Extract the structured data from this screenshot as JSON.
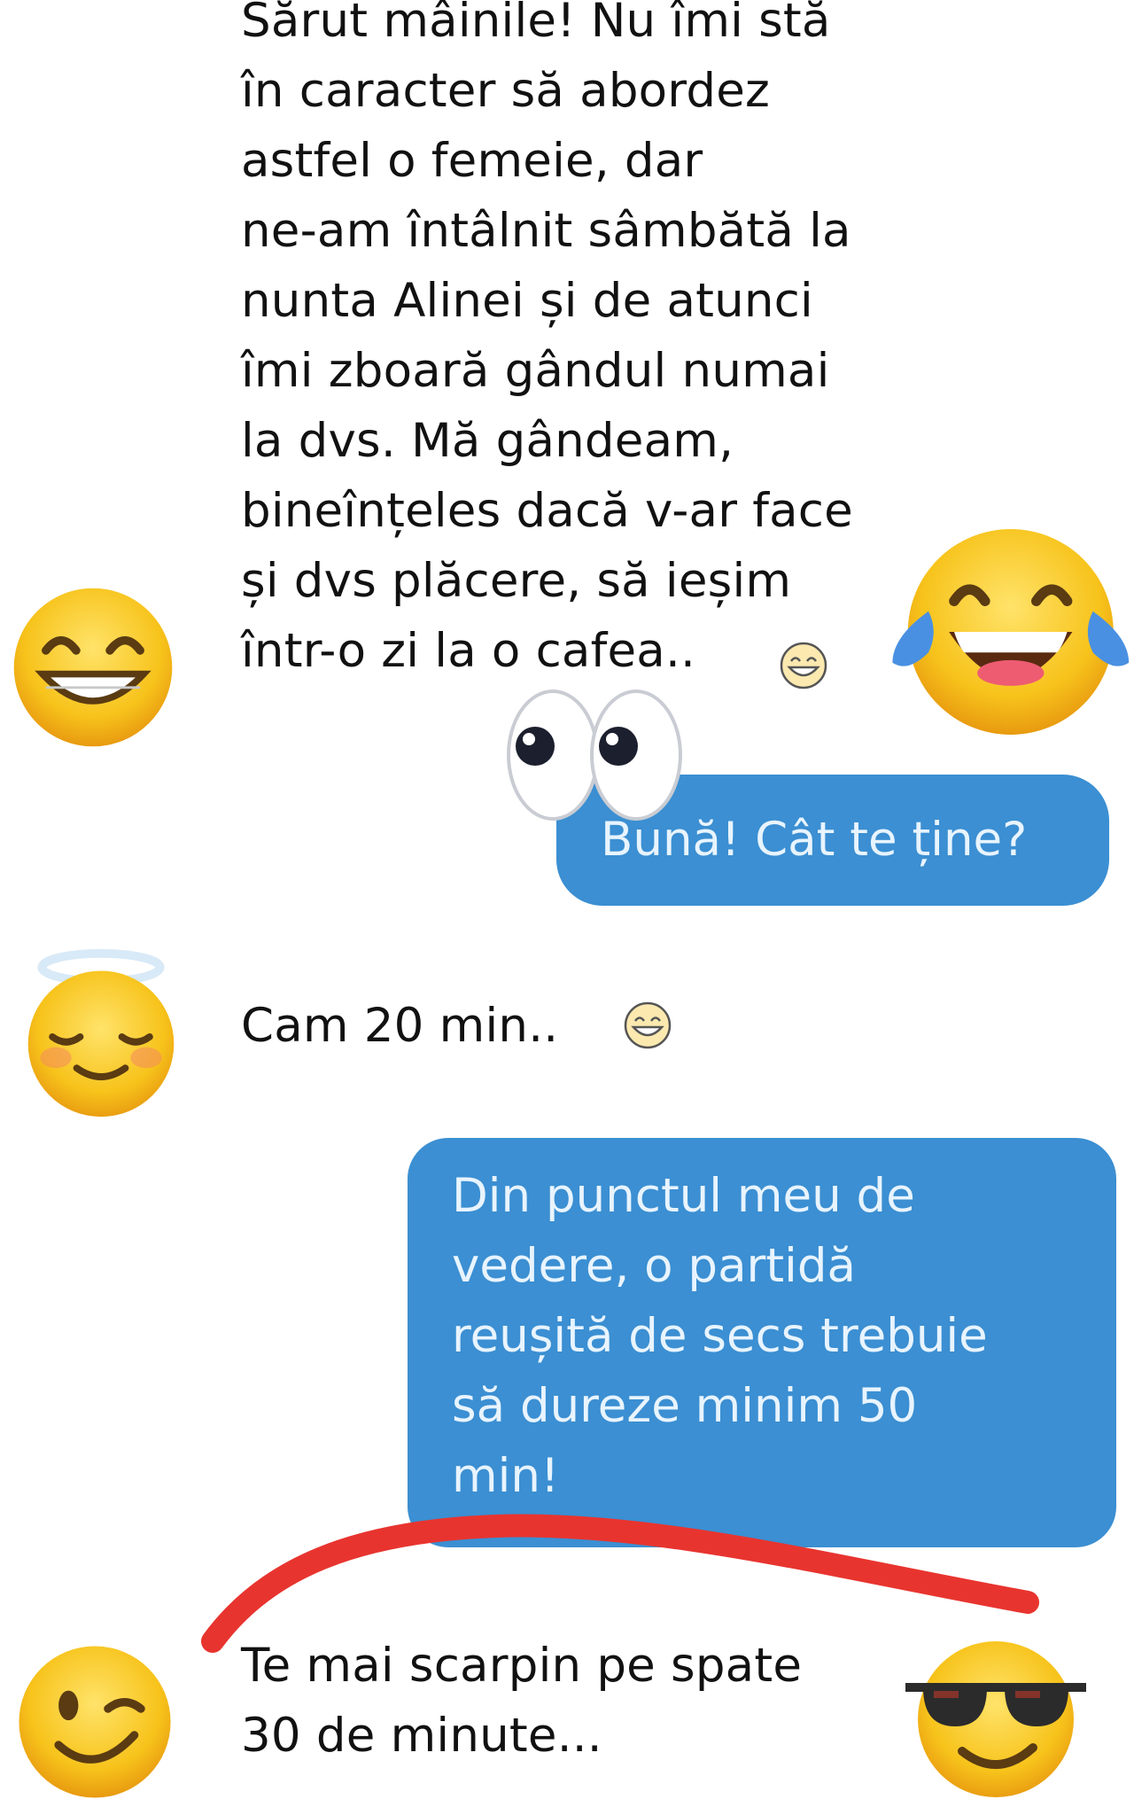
{
  "conversation": {
    "messages": [
      {
        "side": "incoming",
        "text": "Sărut mâinile! Nu îmi stă\nîn caracter să abordez\nastfel o femeie, dar\nne-am întâlnit sâmbătă la\nnunta Alinei și de atunci\nîmi zboară gândul numai\nla dvs. Mă gândeam,\nbineînțeles dacă v-ar face\nși dvs plăcere, să ieșim\nîntr-o zi la o cafea..",
        "trailing_emoji": "grinning-face"
      },
      {
        "side": "outgoing",
        "text": "Bună! Cât te ține?"
      },
      {
        "side": "incoming",
        "text": "Cam 20 min..",
        "trailing_emoji": "grinning-face"
      },
      {
        "side": "outgoing",
        "text": "Din punctul meu de\nvedere, o partidă\nreușită de secs trebuie\nsă dureze minim 50\nmin!"
      },
      {
        "side": "incoming",
        "text": "Te mai scarpin pe spate\n30 de minute..."
      }
    ]
  },
  "stickers": [
    {
      "name": "grinning-face-icon"
    },
    {
      "name": "tears-of-joy-face-icon"
    },
    {
      "name": "eyes-icon"
    },
    {
      "name": "smiling-face-with-halo-icon"
    },
    {
      "name": "winking-face-icon"
    },
    {
      "name": "face-with-sunglasses-icon"
    }
  ],
  "colors": {
    "background": "#ffffff",
    "outgoing_bubble": "#3b8fd2",
    "outgoing_text": "#e8f4ff",
    "incoming_text": "#111111",
    "annotation_stroke": "#e8342f",
    "emoji_yellow": "#f7c31b"
  }
}
